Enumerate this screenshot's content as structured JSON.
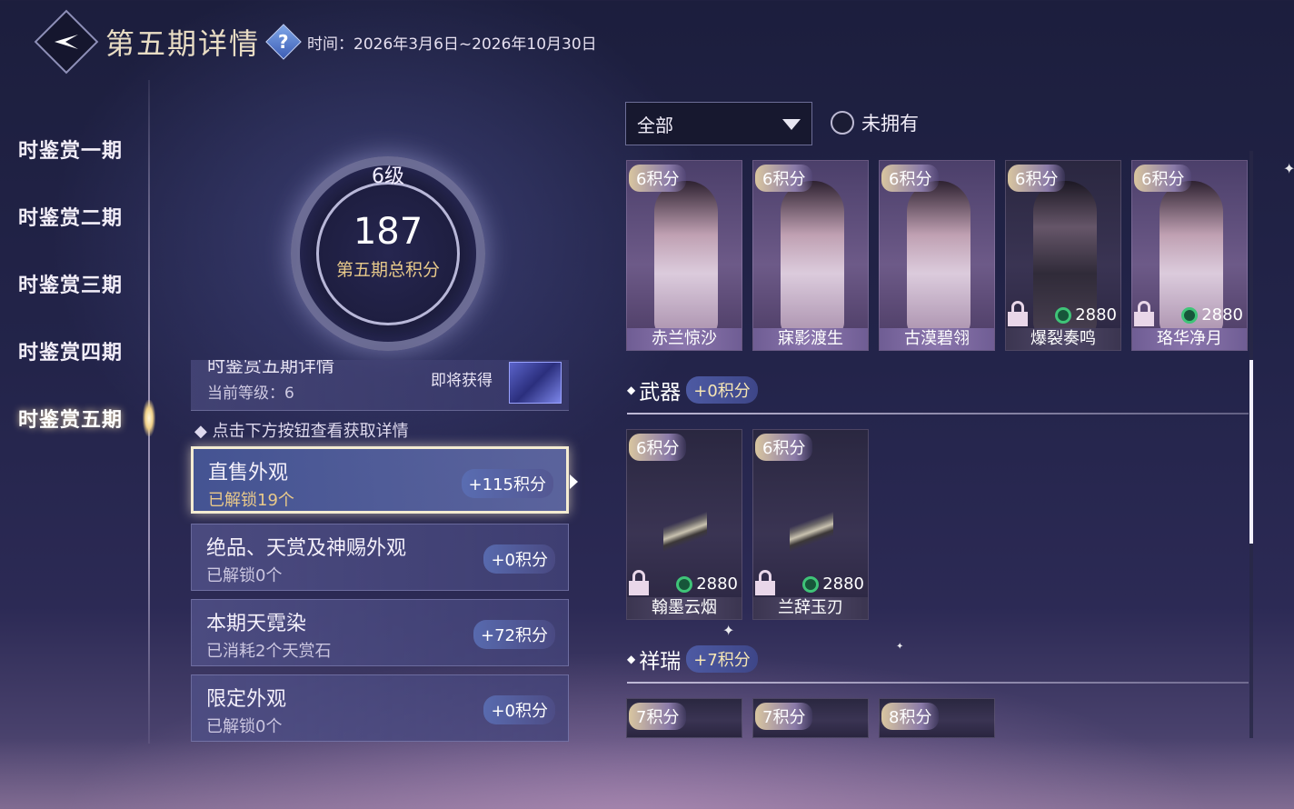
{
  "header": {
    "title": "第五期详情",
    "help": "?",
    "time_label": "时间：",
    "time_range": "2026年3月6日~2026年10月30日"
  },
  "nav": {
    "items": [
      {
        "label": "时鉴赏一期"
      },
      {
        "label": "时鉴赏二期"
      },
      {
        "label": "时鉴赏三期"
      },
      {
        "label": "时鉴赏四期"
      },
      {
        "label": "时鉴赏五期",
        "active": true
      }
    ]
  },
  "score": {
    "level": "6级",
    "total": "187",
    "label": "第五期总积分"
  },
  "detail": {
    "title": "时鉴赏五期详情",
    "current_level": "当前等级：6",
    "upcoming": "即将获得"
  },
  "hint": "点击下方按钮查看获取详情",
  "rows": [
    {
      "name": "直售外观",
      "sub": "已解锁19个",
      "points": "+115积分",
      "active": true
    },
    {
      "name": "绝品、天赏及神赐外观",
      "sub": "已解锁0个",
      "points": "+0积分"
    },
    {
      "name": "本期天霓染",
      "sub": "已消耗2个天赏石",
      "points": "+72积分"
    },
    {
      "name": "限定外观",
      "sub": "已解锁0个",
      "points": "+0积分"
    }
  ],
  "filter": {
    "dropdown": "全部",
    "checkbox_label": "未拥有"
  },
  "outfits": [
    {
      "badge": "6积分",
      "name": "赤兰惊沙"
    },
    {
      "badge": "6积分",
      "name": "寐影渡生"
    },
    {
      "badge": "6积分",
      "name": "古漠碧翎"
    },
    {
      "badge": "6积分",
      "name": "爆裂奏鸣",
      "locked": true,
      "price": "2880"
    },
    {
      "badge": "6积分",
      "name": "珞华净月",
      "locked": true,
      "price": "2880"
    }
  ],
  "weapon_section": {
    "title": "武器",
    "points": "+0积分"
  },
  "weapons": [
    {
      "badge": "6积分",
      "name": "翰墨云烟",
      "price": "2880"
    },
    {
      "badge": "6积分",
      "name": "兰辞玉刃",
      "price": "2880"
    }
  ],
  "auspicious_section": {
    "title": "祥瑞",
    "points": "+7积分"
  },
  "auspicious": [
    {
      "badge": "7积分"
    },
    {
      "badge": "7积分"
    },
    {
      "badge": "8积分"
    }
  ],
  "colors": {
    "accent_gold": "#e7c98a",
    "jade": "#3fc478"
  }
}
